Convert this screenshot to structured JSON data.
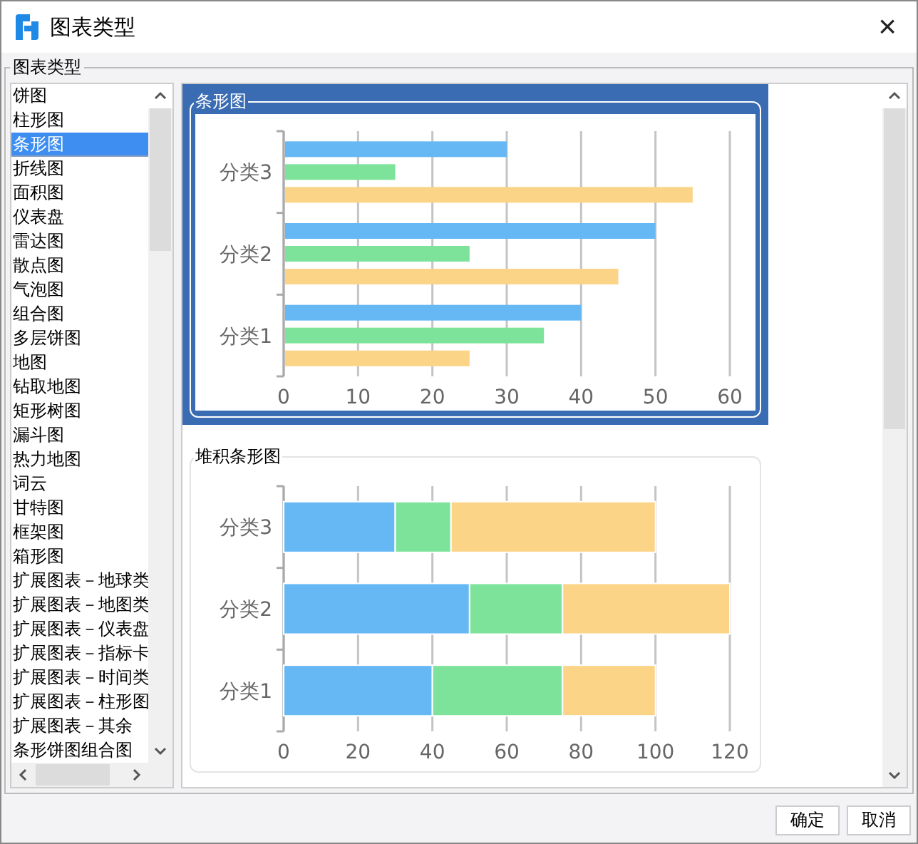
{
  "window": {
    "title": "图表类型",
    "close": "×"
  },
  "group": {
    "label": "图表类型"
  },
  "types": [
    {
      "label": "饼图",
      "selected": false
    },
    {
      "label": "柱形图",
      "selected": false
    },
    {
      "label": "条形图",
      "selected": true
    },
    {
      "label": "折线图",
      "selected": false
    },
    {
      "label": "面积图",
      "selected": false
    },
    {
      "label": "仪表盘",
      "selected": false
    },
    {
      "label": "雷达图",
      "selected": false
    },
    {
      "label": "散点图",
      "selected": false
    },
    {
      "label": "气泡图",
      "selected": false
    },
    {
      "label": "组合图",
      "selected": false
    },
    {
      "label": "多层饼图",
      "selected": false
    },
    {
      "label": "地图",
      "selected": false
    },
    {
      "label": "钻取地图",
      "selected": false
    },
    {
      "label": "矩形树图",
      "selected": false
    },
    {
      "label": "漏斗图",
      "selected": false
    },
    {
      "label": "热力地图",
      "selected": false
    },
    {
      "label": "词云",
      "selected": false
    },
    {
      "label": "甘特图",
      "selected": false
    },
    {
      "label": "框架图",
      "selected": false
    },
    {
      "label": "箱形图",
      "selected": false
    },
    {
      "label": "扩展图表－地球类",
      "selected": false
    },
    {
      "label": "扩展图表－地图类",
      "selected": false
    },
    {
      "label": "扩展图表－仪表盘",
      "selected": false
    },
    {
      "label": "扩展图表－指标卡",
      "selected": false
    },
    {
      "label": "扩展图表－时间类",
      "selected": false
    },
    {
      "label": "扩展图表－柱形图",
      "selected": false
    },
    {
      "label": "扩展图表－其余",
      "selected": false
    },
    {
      "label": "条形饼图组合图",
      "selected": false
    }
  ],
  "previews": [
    {
      "title": "条形图",
      "selected": true,
      "chart_data": {
        "type": "bar",
        "orientation": "horizontal",
        "stacked": false,
        "grid": true,
        "categories": [
          "分类3",
          "分类2",
          "分类1"
        ],
        "xlim": [
          0,
          60
        ],
        "xticks": [
          0,
          10,
          20,
          30,
          40,
          50,
          60
        ],
        "series": [
          {
            "color": "#66b8f5",
            "values": [
              30,
              50,
              40
            ]
          },
          {
            "color": "#7ee39a",
            "values": [
              15,
              25,
              35
            ]
          },
          {
            "color": "#fcd487",
            "values": [
              55,
              45,
              25
            ]
          }
        ]
      }
    },
    {
      "title": "堆积条形图",
      "selected": false,
      "chart_data": {
        "type": "bar",
        "orientation": "horizontal",
        "stacked": true,
        "grid": true,
        "categories": [
          "分类3",
          "分类2",
          "分类1"
        ],
        "xlim": [
          0,
          120
        ],
        "xticks": [
          0,
          20,
          40,
          60,
          80,
          100,
          120
        ],
        "series": [
          {
            "color": "#66b8f5",
            "values": [
              30,
              50,
              40
            ]
          },
          {
            "color": "#7ee39a",
            "values": [
              15,
              25,
              35
            ]
          },
          {
            "color": "#fcd487",
            "values": [
              55,
              45,
              25
            ]
          }
        ]
      }
    }
  ],
  "buttons": [
    {
      "label": "确定"
    },
    {
      "label": "取消"
    }
  ]
}
